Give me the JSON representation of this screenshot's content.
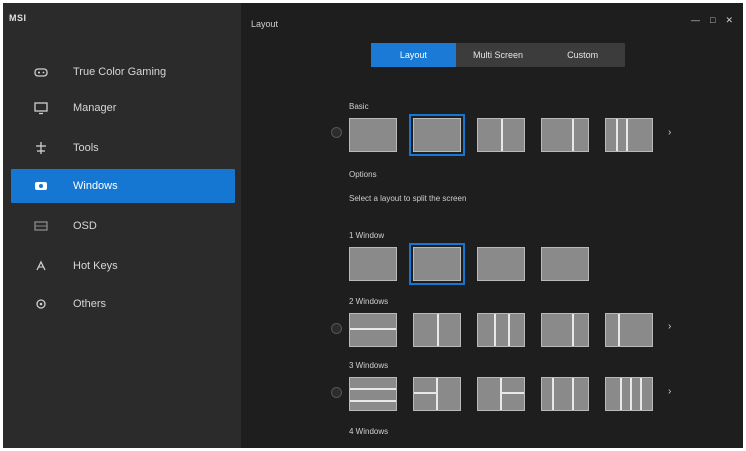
{
  "app": {
    "logo": "MSI",
    "title": "Layout"
  },
  "window_controls": [
    "minimize-icon",
    "maximize-icon",
    "close-icon"
  ],
  "sidebar": {
    "items": [
      {
        "label": "True Color Gaming",
        "icon": "gamepad-icon",
        "active": false
      },
      {
        "label": "Manager",
        "icon": "monitor-icon",
        "active": false
      },
      {
        "label": "Tools",
        "icon": "tools-icon",
        "active": false
      },
      {
        "label": "Windows",
        "icon": "windows-icon",
        "active": true
      },
      {
        "label": "OSD",
        "icon": "osd-icon",
        "active": false
      },
      {
        "label": "Hot Keys",
        "icon": "keyboard-icon",
        "active": false
      },
      {
        "label": "Others",
        "icon": "settings-icon",
        "active": false
      }
    ]
  },
  "tabs": [
    {
      "label": "Layout",
      "active": true
    },
    {
      "label": "Multi Screen",
      "active": false
    },
    {
      "label": "Custom",
      "active": false
    }
  ],
  "sections": {
    "basic": {
      "label": "Basic",
      "sublabel": "Options"
    },
    "description": "Select a layout to split the screen",
    "one_screen": {
      "label": "1 Window"
    },
    "two_screen": {
      "label": "2 Windows"
    },
    "three_screen": {
      "label": "3 Windows"
    },
    "four_screen": {
      "label": "4 Windows"
    }
  },
  "colors": {
    "accent": "#1677d2",
    "sidebar_bg": "#2b2b2b",
    "main_bg": "#1e1e1e",
    "tile": "#8a8a8a"
  }
}
